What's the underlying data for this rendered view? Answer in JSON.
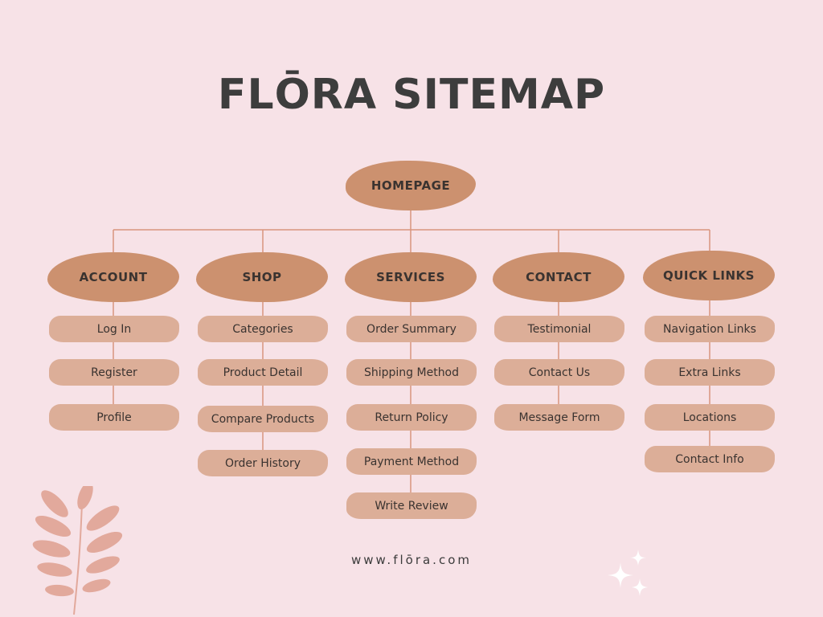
{
  "title": "FLŌRA SITEMAP",
  "root": "HOMEPAGE",
  "columns": [
    {
      "heading": "ACCOUNT",
      "items": [
        "Log In",
        "Register",
        "Profile"
      ]
    },
    {
      "heading": "SHOP",
      "items": [
        "Categories",
        "Product Detail",
        "Compare Products",
        "Order History"
      ]
    },
    {
      "heading": "SERVICES",
      "items": [
        "Order Summary",
        "Shipping Method",
        "Return Policy",
        "Payment Method",
        "Write Review"
      ]
    },
    {
      "heading": "CONTACT",
      "items": [
        "Testimonial",
        "Contact Us",
        "Message Form"
      ]
    },
    {
      "heading": "QUICK LINKS",
      "items": [
        "Navigation Links",
        "Extra Links",
        "Locations",
        "Contact Info"
      ]
    }
  ],
  "footer": "www.flōra.com",
  "colors": {
    "background": "#f7e2e7",
    "node": "#cc916f",
    "leaf": "#dcae98",
    "connector": "#d9957e",
    "leaf_decor": "#e2a99c",
    "sparkle": "#ffffff"
  },
  "decorations": [
    "leaf-branch-icon",
    "sparkle-icon"
  ]
}
